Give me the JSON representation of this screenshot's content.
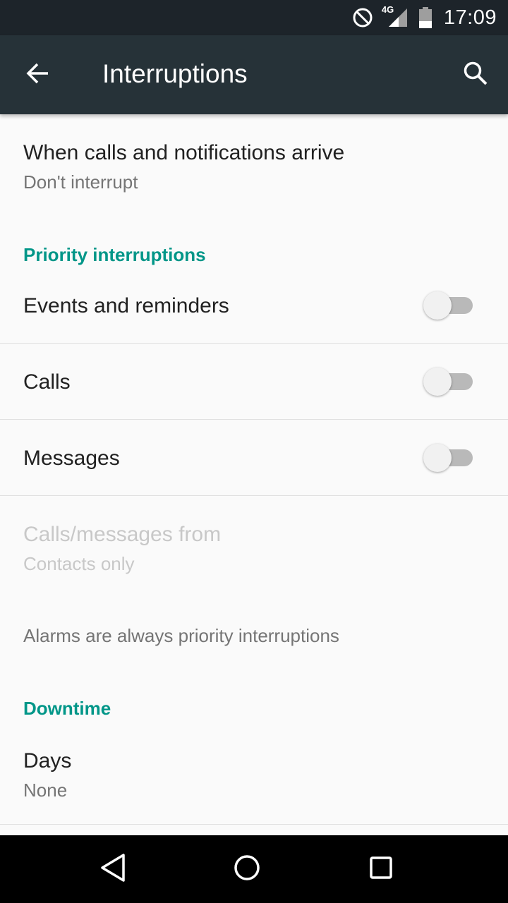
{
  "status_bar": {
    "time": "17:09",
    "network": "4G",
    "icons": [
      "do-not-disturb-icon",
      "cellular-signal-icon",
      "battery-icon"
    ]
  },
  "app_bar": {
    "title": "Interruptions",
    "back_icon": "arrow-back-icon",
    "search_icon": "search-icon"
  },
  "settings": {
    "when_arrive": {
      "title": "When calls and notifications arrive",
      "summary": "Don't interrupt"
    },
    "priority_header": "Priority interruptions",
    "events": {
      "title": "Events and reminders",
      "enabled": false
    },
    "calls": {
      "title": "Calls",
      "enabled": false
    },
    "messages": {
      "title": "Messages",
      "enabled": false
    },
    "calls_from": {
      "title": "Calls/messages from",
      "summary": "Contacts only",
      "disabled": true
    },
    "alarms_note": "Alarms are always priority interruptions",
    "downtime_header": "Downtime",
    "days": {
      "title": "Days",
      "summary": "None"
    }
  },
  "nav_bar": {
    "back_icon": "nav-back-icon",
    "home_icon": "nav-home-icon",
    "recents_icon": "nav-recents-icon"
  },
  "colors": {
    "status_bar": "#1d242a",
    "app_bar": "#263238",
    "accent": "#009688",
    "background": "#fafafa"
  }
}
